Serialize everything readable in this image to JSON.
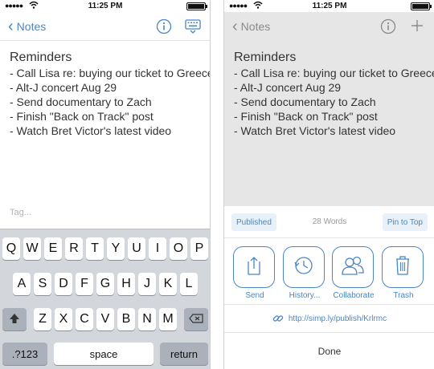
{
  "left": {
    "status": {
      "carrier": "●●●●●",
      "time": "11:25 PM"
    },
    "nav": {
      "back_label": "Notes"
    },
    "note": {
      "title": "Reminders",
      "lines": [
        "- Call Lisa re: buying our ticket to Greece",
        "- Alt-J concert Aug 29",
        "- Send documentary to Zach",
        "- Finish \"Back on Track\" post",
        "- Watch Bret Victor's latest video"
      ]
    },
    "tag_placeholder": "Tag...",
    "keyboard": {
      "row1": [
        "Q",
        "W",
        "E",
        "R",
        "T",
        "Y",
        "U",
        "I",
        "O",
        "P"
      ],
      "row2": [
        "A",
        "S",
        "D",
        "F",
        "G",
        "H",
        "J",
        "K",
        "L"
      ],
      "row3": [
        "Z",
        "X",
        "C",
        "V",
        "B",
        "N",
        "M"
      ],
      "numbers_key": ".?123",
      "space_key": "space",
      "return_key": "return"
    }
  },
  "right": {
    "status": {
      "carrier": "●●●●●",
      "time": "11:25 PM"
    },
    "nav": {
      "back_label": "Notes"
    },
    "note": {
      "title": "Reminders",
      "lines": [
        "- Call Lisa re: buying our ticket to Greece",
        "- Alt-J concert Aug 29",
        "- Send documentary to Zach",
        "- Finish \"Back on Track\" post",
        "- Watch Bret Victor's latest video"
      ]
    },
    "sheet": {
      "published_label": "Published",
      "word_count": "28 Words",
      "pin_label": "Pin to Top",
      "actions": [
        {
          "label": "Send",
          "icon": "send-icon"
        },
        {
          "label": "History...",
          "icon": "history-icon"
        },
        {
          "label": "Collaborate",
          "icon": "collaborate-icon"
        },
        {
          "label": "Trash",
          "icon": "trash-icon"
        }
      ],
      "publish_url": "http://simp.ly/publish/Krlrmc",
      "done_label": "Done"
    }
  },
  "colors": {
    "accent": "#4a86c5",
    "keyboard_bg": "#d3d6db",
    "dimmed_bg": "#e6e6e6"
  }
}
